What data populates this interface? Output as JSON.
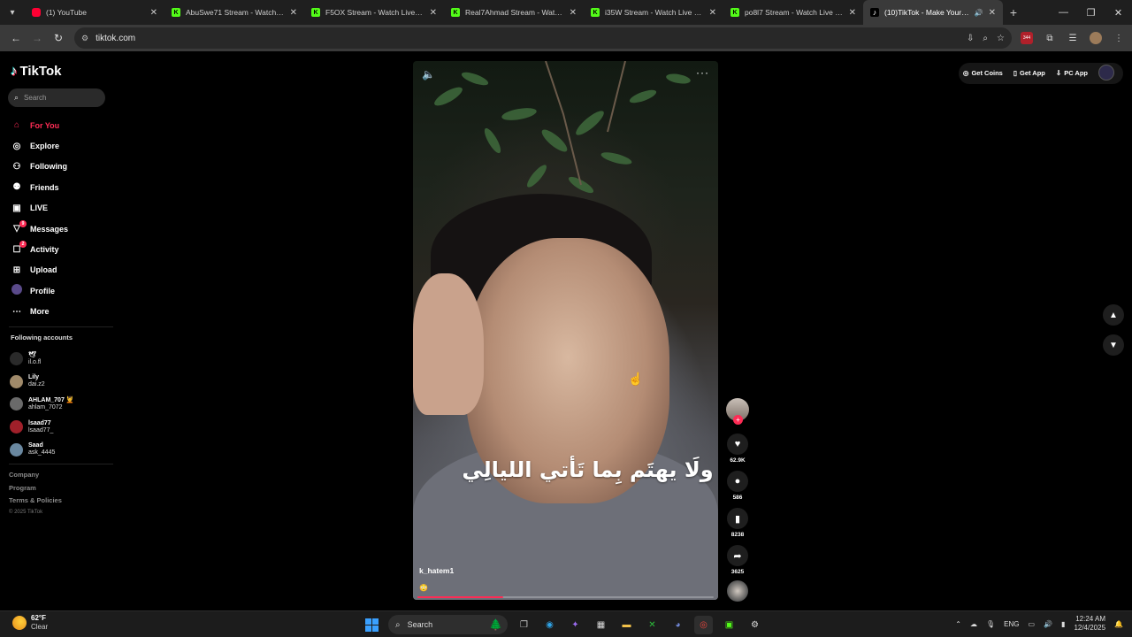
{
  "browser": {
    "tabs": [
      {
        "title": "(1) YouTube",
        "favicon": "youtube-icon",
        "active": false
      },
      {
        "title": "AbuSwe71 Stream - Watch Live",
        "favicon": "kick-icon",
        "active": false
      },
      {
        "title": "F5OX Stream - Watch Live on K",
        "favicon": "kick-icon",
        "active": false
      },
      {
        "title": "Real7Ahmad Stream - Watch Li",
        "favicon": "kick-icon",
        "active": false
      },
      {
        "title": "i35W Stream - Watch Live on K",
        "favicon": "kick-icon",
        "active": false
      },
      {
        "title": "po8l7 Stream - Watch Live on K",
        "favicon": "kick-icon",
        "active": false
      },
      {
        "title": "(10)TikTok - Make Your Day",
        "favicon": "tiktok-icon",
        "active": true
      }
    ],
    "url": "tiktok.com",
    "extension_badge": "344"
  },
  "sidebar": {
    "logo": "TikTok",
    "search_placeholder": "Search",
    "nav": [
      {
        "label": "For You",
        "icon": "home-icon"
      },
      {
        "label": "Explore",
        "icon": "compass-icon"
      },
      {
        "label": "Following",
        "icon": "following-icon"
      },
      {
        "label": "Friends",
        "icon": "friends-icon"
      },
      {
        "label": "LIVE",
        "icon": "live-icon"
      },
      {
        "label": "Messages",
        "icon": "messages-icon",
        "badge": "9"
      },
      {
        "label": "Activity",
        "icon": "activity-icon",
        "badge": "2"
      },
      {
        "label": "Upload",
        "icon": "upload-icon"
      },
      {
        "label": "Profile",
        "icon": "profile-icon"
      },
      {
        "label": "More",
        "icon": "more-icon"
      }
    ],
    "following_title": "Following accounts",
    "following": [
      {
        "name": "🕊",
        "handle": "il.o.fl"
      },
      {
        "name": "Lily",
        "handle": "dai.z2"
      },
      {
        "name": "AHLAM_707 💆",
        "handle": "ahlam_7072"
      },
      {
        "name": "lsaad77",
        "handle": "lsaad77_"
      },
      {
        "name": "Saad",
        "handle": "ask_4445"
      }
    ],
    "footer": [
      "Company",
      "Program",
      "Terms & Policies"
    ],
    "copyright": "© 2025 TikTok"
  },
  "top_actions": {
    "get_coins": "Get Coins",
    "get_app": "Get App",
    "pc_app": "PC App"
  },
  "video": {
    "caption": "ولَا يهتَم بِما تَأتي الليالِي",
    "author": "k_hatem1",
    "description": "😳",
    "progress": 0.29
  },
  "actions": {
    "likes": "62.9K",
    "comments": "586",
    "saves": "8238",
    "shares": "3625"
  },
  "taskbar": {
    "temperature": "62°F",
    "condition": "Clear",
    "search": "Search",
    "language": "ENG",
    "time": "12:24 AM",
    "date": "12/4/2025"
  },
  "colors": {
    "accent": "#fe2c55",
    "background": "#000000"
  }
}
